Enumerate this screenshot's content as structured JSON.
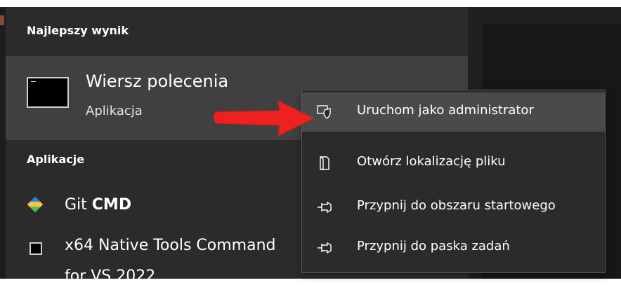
{
  "search": {
    "best_result_header": "Najlepszy wynik",
    "best_result": {
      "title": "Wiersz polecenia",
      "subtitle": "Aplikacja",
      "icon": "command-prompt-icon"
    },
    "apps_header": "Aplikacje",
    "apps": [
      {
        "label_prefix": "Git ",
        "label_bold": "CMD",
        "icon": "git-icon"
      },
      {
        "label": "x64 Native Tools Command",
        "label_overflow": "for VS 2022",
        "icon": "command-prompt-icon"
      }
    ]
  },
  "context_menu": {
    "items": [
      {
        "label": "Uruchom jako administrator",
        "icon": "admin-shield-icon",
        "active": true
      },
      {
        "label": "Otwórz lokalizację pliku",
        "icon": "file-location-icon",
        "active": false
      },
      {
        "label": "Przypnij do obszaru startowego",
        "icon": "pin-icon",
        "active": false
      },
      {
        "label": "Przypnij do paska zadań",
        "icon": "pin-icon",
        "active": false
      }
    ]
  },
  "colors": {
    "panel_background": "#2b2b2b",
    "selected_background": "#404040",
    "menu_hover": "#4a4a4a",
    "arrow": "#ef2020",
    "text": "#ffffff"
  }
}
